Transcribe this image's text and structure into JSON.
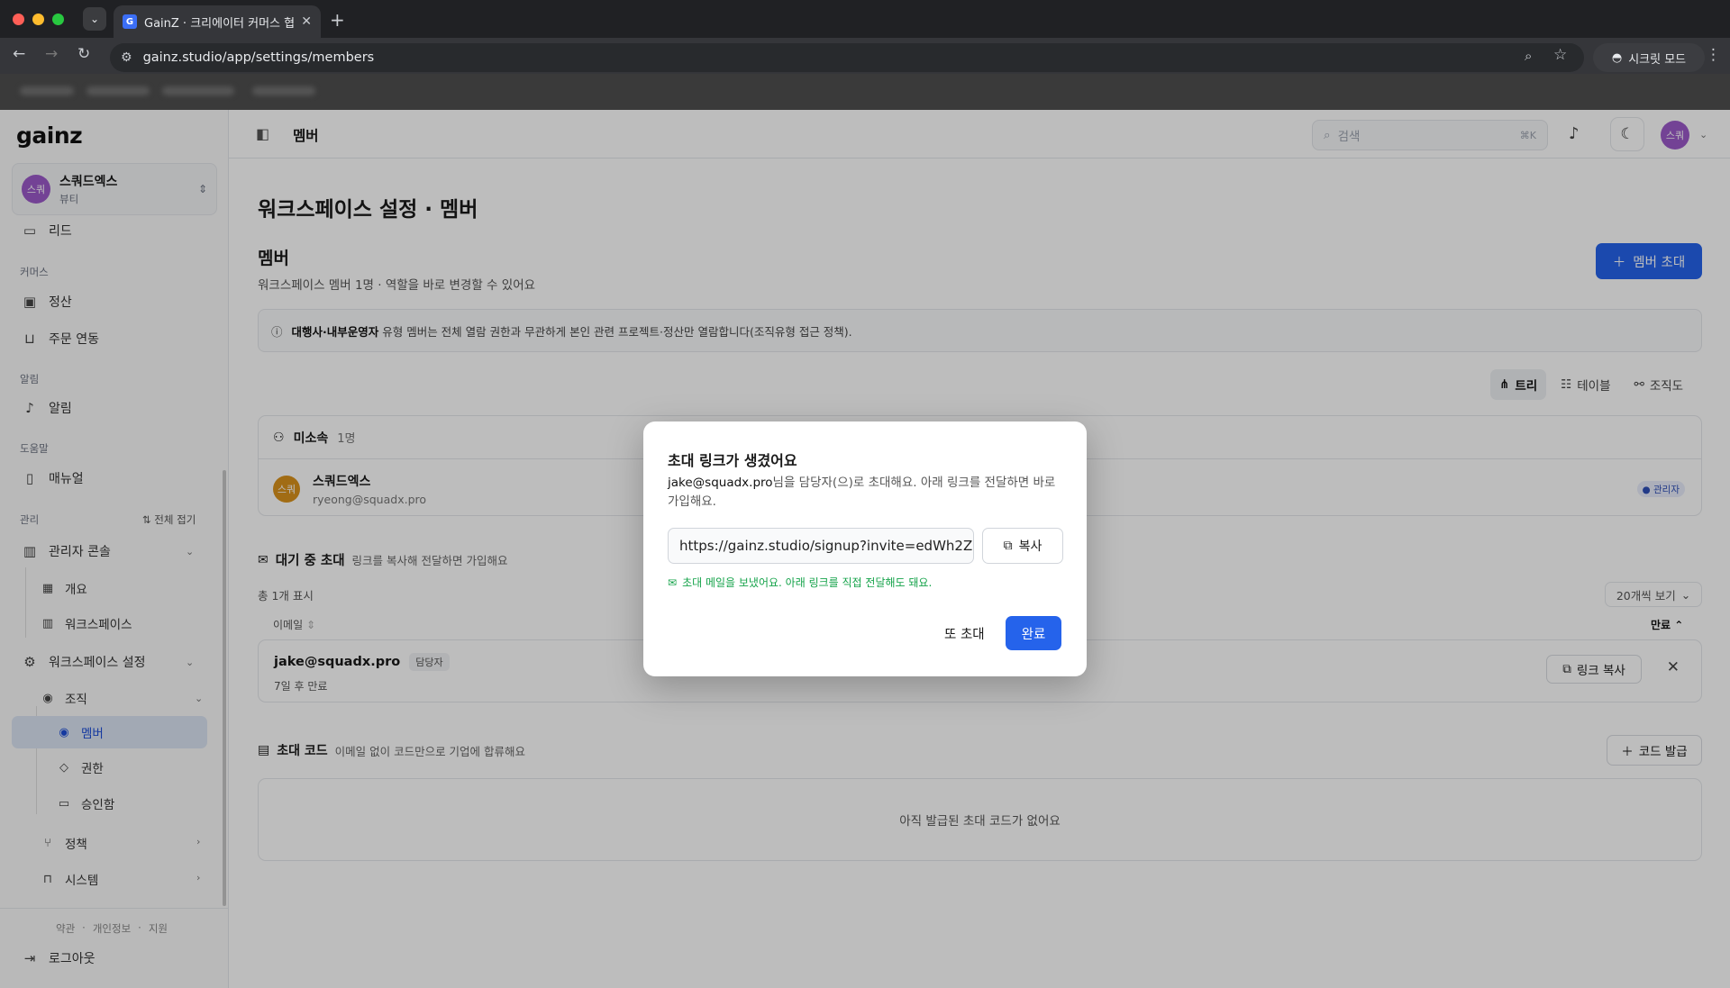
{
  "browser": {
    "tab_title": "GainZ · 크리에이터 커머스 협업 C",
    "tab_favicon": "G",
    "url": "gainz.studio/app/settings/members",
    "incognito_label": "시크릿 모드"
  },
  "sidebar": {
    "logo": "gainz",
    "workspace": {
      "avatar": "스쿼",
      "name": "스쿼드엑스",
      "subtitle": "뷰티"
    },
    "items": {
      "lead": "리드",
      "commerce_section": "커머스",
      "settlement": "정산",
      "order_sync": "주문 연동",
      "alert_section": "알림",
      "alerts": "알림",
      "help_section": "도움말",
      "manual": "매뉴얼",
      "manage_section": "관리",
      "collapse_all": "전체 접기",
      "admin_console": "관리자 콘솔",
      "overview": "개요",
      "workspaces": "워크스페이스",
      "ws_settings": "워크스페이스 설정",
      "org": "조직",
      "members": "멤버",
      "permissions": "권한",
      "approvals": "승인함",
      "policy": "정책",
      "system": "시스템"
    },
    "footer": {
      "terms": "약관",
      "privacy": "개인정보",
      "support": "지원",
      "sep": "·",
      "logout": "로그아웃"
    }
  },
  "header": {
    "title": "멤버",
    "search_placeholder": "검색",
    "search_shortcut": "⌘K",
    "user_avatar": "스쿼"
  },
  "main": {
    "page_title": "워크스페이스 설정 · 멤버",
    "members_heading": "멤버",
    "members_subtitle": "워크스페이스 멤버 1명 · 역할을 바로 변경할 수 있어요",
    "invite_button": "멤버 초대",
    "notice_bold": "대행사·내부운영자",
    "notice_text": " 유형 멤버는 전체 열람 권한과 무관하게 본인 관련 프로젝트·정산만 열람합니다(조직유형 접근 정책).",
    "views": {
      "tree": "트리",
      "table": "테이블",
      "orgchart": "조직도"
    },
    "unassigned": {
      "title": "미소속",
      "count": "1명",
      "member": {
        "avatar": "스쿼",
        "name": "스쿼드엑스",
        "email": "ryeong@squadx.pro",
        "role": "● 관리자"
      }
    },
    "pending": {
      "title": "대기 중 초대",
      "subtitle": "링크를 복사해 전달하면 가입해요",
      "total": "총 1개 표시",
      "per_page": "20개씩 보기",
      "col_email": "이메일",
      "col_expiry": "만료",
      "row": {
        "email": "jake@squadx.pro",
        "role": "담당자",
        "expiry": "7일 후 만료",
        "copy_link": "링크 복사"
      }
    },
    "codes": {
      "title": "초대 코드",
      "subtitle": "이메일 없이 코드만으로 기업에 합류해요",
      "issue_button": "코드 발급",
      "empty": "아직 발급된 초대 코드가 없어요"
    }
  },
  "modal": {
    "title": "초대 링크가 생겼어요",
    "desc_email": "jake@squadx.pro",
    "desc_rest": "님을 담당자(으)로 초대해요. 아래 링크를 전달하면 바로 가입해요.",
    "link_value": "https://gainz.studio/signup?invite=edWh2Z",
    "copy_button": "복사",
    "sent_note": "초대 메일을 보냈어요. 아래 링크를 직접 전달해도 돼요.",
    "again_button": "또 초대",
    "done_button": "완료"
  },
  "colors": {
    "accent": "#2563eb",
    "workspace_avatar": "#9b59c9",
    "member_avatar": "#d9921c",
    "success": "#15a34a",
    "active_nav_bg": "#dbe4f3"
  },
  "icons": [
    "search-icon",
    "bell-icon",
    "moon-icon",
    "plus-icon",
    "info-icon",
    "copy-icon",
    "close-icon",
    "mail-icon",
    "users-icon",
    "ticket-icon",
    "tree-icon",
    "table-icon",
    "orgchart-icon",
    "chevron-down-icon",
    "chevron-right-icon",
    "logout-icon"
  ]
}
